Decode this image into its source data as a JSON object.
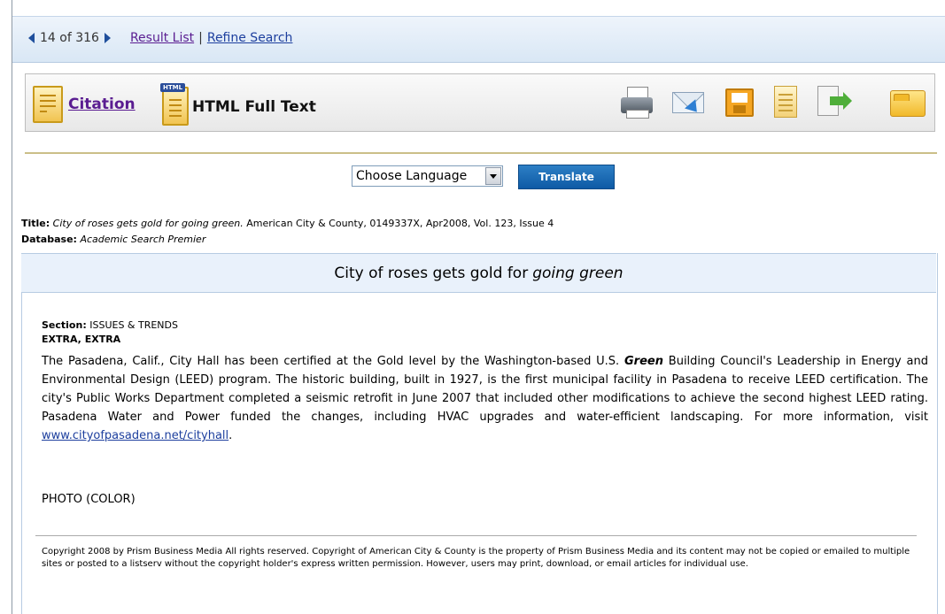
{
  "nav": {
    "position": "14 of 316",
    "result_list": "Result List",
    "separator": "|",
    "refine_search": "Refine Search"
  },
  "formats": {
    "citation_label": "Citation",
    "html_badge": "HTML",
    "fulltext_label": "HTML Full Text"
  },
  "tools": [
    "printer-icon",
    "email-icon",
    "save-icon",
    "document-icon",
    "export-icon",
    "folder-icon"
  ],
  "translate": {
    "language_value": "Choose Language",
    "button_label": "Translate"
  },
  "meta": {
    "title_label": "Title:",
    "title_italic": "City of roses gets gold for going green.",
    "title_rest": "American City & County, 0149337X, Apr2008, Vol. 123, Issue 4",
    "database_label": "Database:",
    "database_value": "Academic Search Premier"
  },
  "article": {
    "headline_plain": "City of roses gets gold for",
    "headline_italic": "going green",
    "section_label": "Section:",
    "section_value": "ISSUES & TRENDS",
    "subhead": "EXTRA, EXTRA",
    "body_part1": "The Pasadena, Calif., City Hall has been certified at the Gold level by the Washington-based U.S.",
    "body_emphasis": "Green",
    "body_part2": "Building Council's Leadership in Energy and Environmental Design (LEED) program. The historic building, built in 1927, is the first municipal facility in Pasadena to receive LEED certification. The city's Public Works Department completed a seismic retrofit in June 2007 that included other modifications to achieve the second highest LEED rating. Pasadena Water and Power funded the changes, including HVAC upgrades and water-efficient landscaping. For more information, visit",
    "body_link": "www.cityofpasadena.net/cityhall",
    "body_end": ".",
    "photo": "PHOTO (COLOR)",
    "copyright": "Copyright 2008 by Prism Business Media All rights reserved. Copyright of American City & County is the property of Prism Business Media and its content may not be copied or emailed to multiple sites or posted to a listserv without the copyright holder's express written permission. However, users may print, download, or email articles for individual use."
  }
}
